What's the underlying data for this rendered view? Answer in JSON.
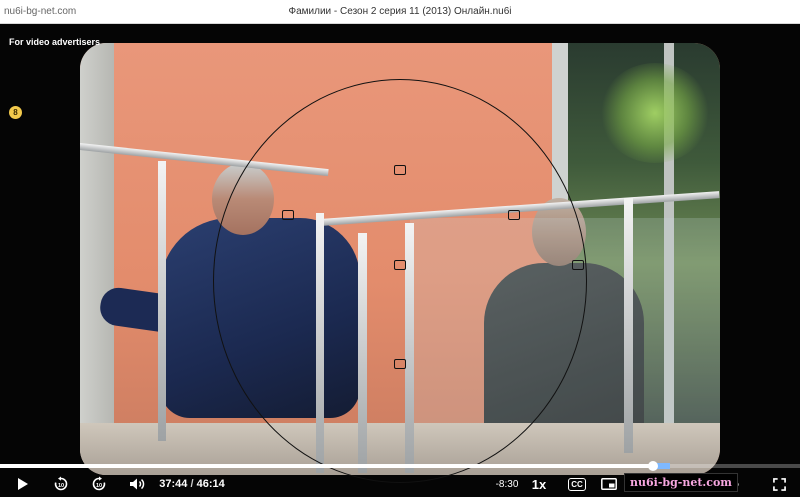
{
  "window": {
    "url": "nu6i-bg-net.com",
    "title": "Фамилии - Сезон 2 серия 11 (2013) Онлайн.nu6i"
  },
  "overlay": {
    "ad_label": "For video advertisers",
    "badge_text": "8"
  },
  "player": {
    "current_time": "37:44",
    "time_separator": "/",
    "duration": "46:14",
    "remaining": "-8:30",
    "speed": "1x",
    "cc_label": "CC",
    "progress_fraction": 0.816,
    "watermark": "nu6i-bg-net.com"
  },
  "icons": {
    "play": "play-icon",
    "rewind": "replay-10-icon",
    "forward": "forward-10-icon",
    "volume": "volume-icon",
    "captions": "captions-icon",
    "pip": "picture-in-picture-icon",
    "settings": "gear-icon",
    "fullscreen": "fullscreen-icon"
  },
  "colors": {
    "wall": "#e38c6c",
    "watermark_text": "#f7a6e0",
    "progress_hover": "#7fb9ff",
    "badge": "#f2c94c"
  }
}
